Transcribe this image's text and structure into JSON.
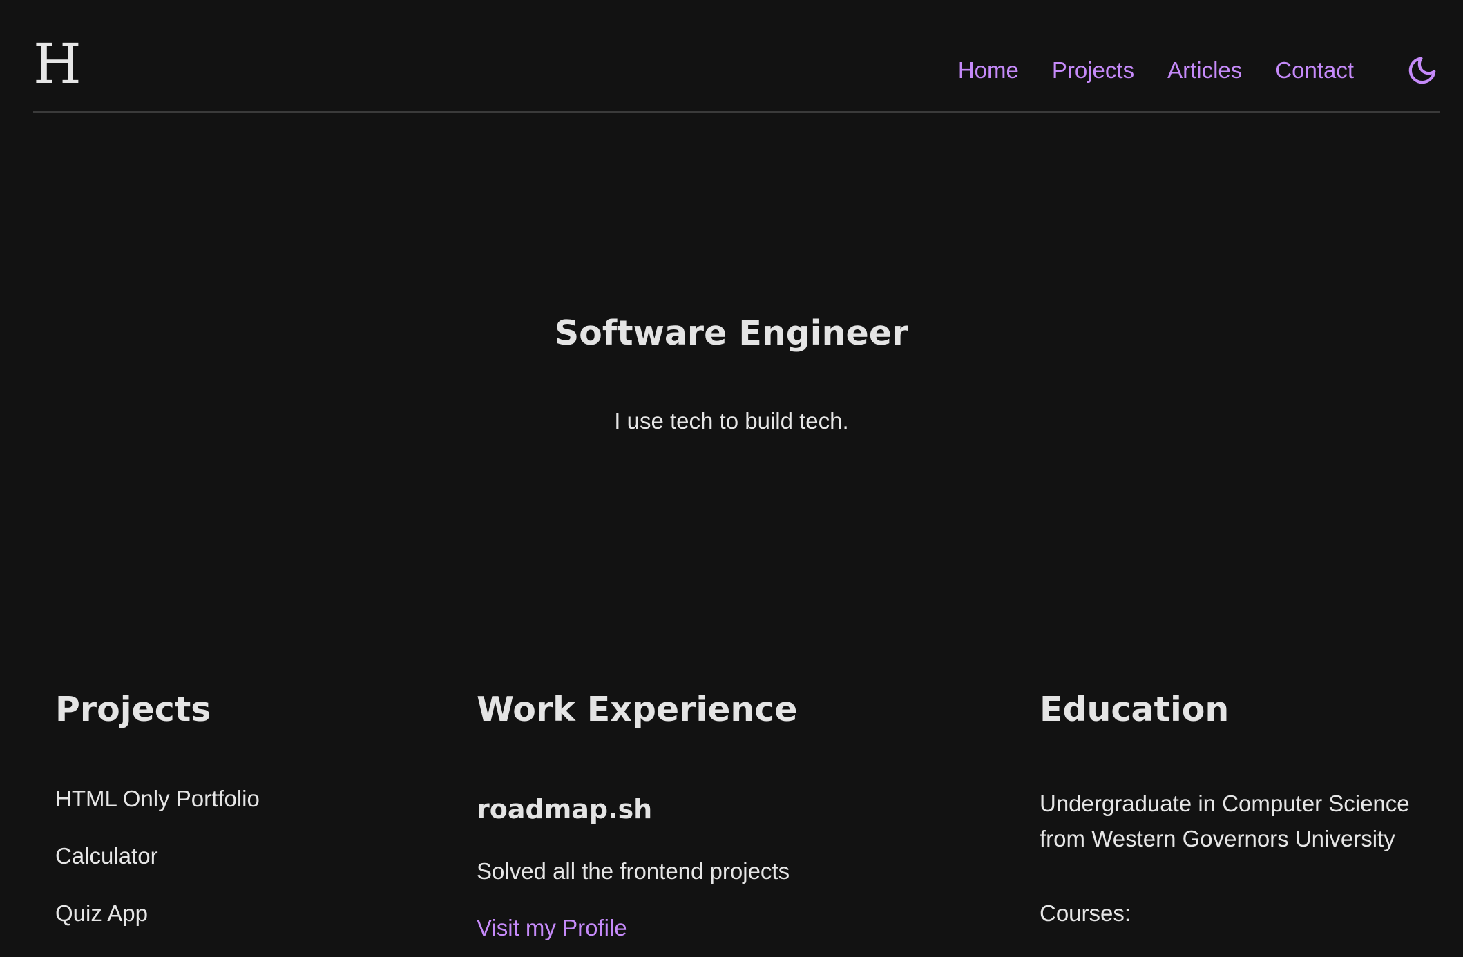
{
  "header": {
    "logo": "H",
    "nav": [
      {
        "label": "Home"
      },
      {
        "label": "Projects"
      },
      {
        "label": "Articles"
      },
      {
        "label": "Contact"
      }
    ],
    "theme_icon": "moon-icon"
  },
  "hero": {
    "title": "Software Engineer",
    "tagline": "I use tech to build tech."
  },
  "projects": {
    "heading": "Projects",
    "items": [
      {
        "label": "HTML Only Portfolio"
      },
      {
        "label": "Calculator"
      },
      {
        "label": "Quiz App"
      }
    ]
  },
  "work": {
    "heading": "Work Experience",
    "company": "roadmap.sh",
    "description": "Solved all the frontend projects",
    "link_label": "Visit my Profile"
  },
  "education": {
    "heading": "Education",
    "degree": "Undergraduate in Computer Science from Western Governors University",
    "courses_label": "Courses:"
  },
  "colors": {
    "background": "#121212",
    "accent": "#c58af9",
    "text": "#e6e6e6",
    "divider": "#3a3a3a"
  }
}
